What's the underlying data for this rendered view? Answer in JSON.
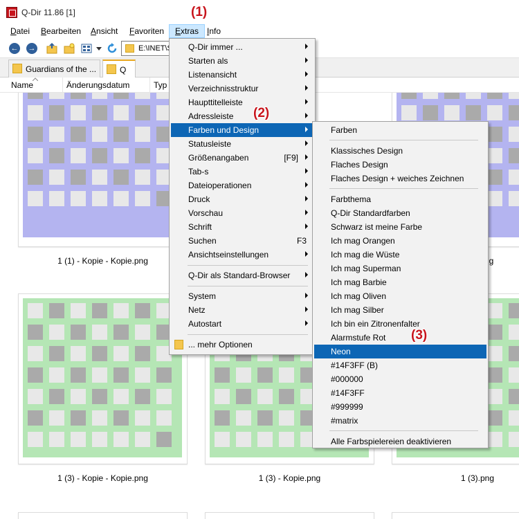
{
  "window": {
    "title": "Q-Dir 11.86 [1]"
  },
  "menubar": {
    "items": [
      {
        "label": "Datei",
        "key": "D",
        "rest": "atei"
      },
      {
        "label": "Bearbeiten",
        "key": "B",
        "rest": "earbeiten"
      },
      {
        "label": "Ansicht",
        "key": "A",
        "rest": "nsicht"
      },
      {
        "label": "Favoriten",
        "key": "F",
        "rest": "avoriten"
      },
      {
        "label": "Extras",
        "key": "E",
        "rest": "xtras"
      },
      {
        "label": "Info",
        "key": "I",
        "rest": "nfo"
      }
    ]
  },
  "address": {
    "value": "E:\\INET\\S"
  },
  "tabs": [
    {
      "label": "Guardians of the ..."
    },
    {
      "label": "Q"
    }
  ],
  "columns": [
    "Name",
    "Änderungsdatum",
    "Typ"
  ],
  "files": [
    {
      "caption": "1 (1) - Kopie - Kopie.png"
    },
    {
      "caption": "ng"
    },
    {
      "caption": "1 (3) - Kopie - Kopie.png"
    },
    {
      "caption": "1 (3) - Kopie.png"
    },
    {
      "caption": "1 (3).png"
    }
  ],
  "colors": {
    "menu_highlight": "#0d66b5",
    "thumb_blue": "#b4b4f0",
    "thumb_green": "#b5e6b5",
    "thumb_cell": "#e8e8e8",
    "thumb_cell_dark": "#aaaaaa",
    "callout": "#c8141c"
  },
  "extras_menu": {
    "items": [
      {
        "label": "Q-Dir immer ...",
        "submenu": true
      },
      {
        "label": "Starten als",
        "submenu": true
      },
      {
        "label": "Listenansicht",
        "submenu": true
      },
      {
        "label": "Verzeichnisstruktur",
        "submenu": true
      },
      {
        "label": "Haupttitelleiste",
        "submenu": true
      },
      {
        "label": "Adressleiste",
        "submenu": true
      },
      {
        "label": "Farben und Design",
        "submenu": true,
        "highlighted": true
      },
      {
        "label": "Statusleiste",
        "submenu": true
      },
      {
        "label": "Größenangaben",
        "shortcut": "[F9]",
        "submenu": true
      },
      {
        "label": "Tab-s",
        "submenu": true
      },
      {
        "label": "Dateioperationen",
        "submenu": true
      },
      {
        "label": "Druck",
        "submenu": true
      },
      {
        "label": "Vorschau",
        "submenu": true
      },
      {
        "label": "Schrift",
        "submenu": true
      },
      {
        "label": "Suchen",
        "shortcut": "F3"
      },
      {
        "label": "Ansichtseinstellungen",
        "submenu": true
      },
      {
        "label": "Q-Dir als Standard-Browser",
        "submenu": true
      },
      {
        "label": "System",
        "submenu": true
      },
      {
        "label": "Netz",
        "submenu": true
      },
      {
        "label": "Autostart",
        "submenu": true
      },
      {
        "label": "... mehr Optionen",
        "icon": "folder-icon"
      }
    ]
  },
  "farben_menu": {
    "items": [
      {
        "label": "Farben"
      },
      {
        "label": "Klassisches Design"
      },
      {
        "label": "Flaches Design"
      },
      {
        "label": "Flaches Design + weiches Zeichnen"
      },
      {
        "label": "Farbthema"
      },
      {
        "label": "Q-Dir Standardfarben"
      },
      {
        "label": "Schwarz ist meine Farbe"
      },
      {
        "label": "Ich mag Orangen"
      },
      {
        "label": "Ich mag die Wüste"
      },
      {
        "label": "Ich mag Superman"
      },
      {
        "label": "Ich mag Barbie"
      },
      {
        "label": "Ich mag Oliven"
      },
      {
        "label": "Ich mag Silber"
      },
      {
        "label": "Ich bin ein Zitronenfalter"
      },
      {
        "label": "Alarmstufe Rot"
      },
      {
        "label": "Neon",
        "highlighted": true
      },
      {
        "label": "#14F3FF (B)"
      },
      {
        "label": "#000000"
      },
      {
        "label": "#14F3FF"
      },
      {
        "label": "#999999"
      },
      {
        "label": "#matrix"
      },
      {
        "label": "Alle Farbspielereien deaktivieren"
      }
    ]
  },
  "callouts": [
    "(1)",
    "(2)",
    "(3)"
  ]
}
